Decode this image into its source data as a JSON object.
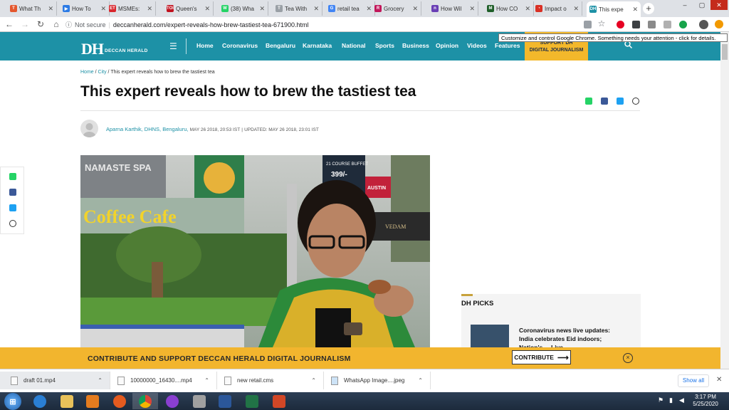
{
  "browser": {
    "tabs": [
      {
        "label": "What Th",
        "fav": "T",
        "color": "#e4572e"
      },
      {
        "label": "How To",
        "fav": "▶",
        "color": "#2c7be5"
      },
      {
        "label": "MSMEs:",
        "fav": "ET",
        "color": "#d9262c"
      },
      {
        "label": "Queen's",
        "fav": "TOI",
        "color": "#c1121f"
      },
      {
        "label": "(38) Wha",
        "fav": "W",
        "color": "#25d366"
      },
      {
        "label": "Tea With",
        "fav": "T",
        "color": "#9aa0a6"
      },
      {
        "label": "retail tea",
        "fav": "G",
        "color": "#4285f4"
      },
      {
        "label": "Grocery",
        "fav": "R",
        "color": "#c2185b"
      },
      {
        "label": "How Wil",
        "fav": "n",
        "color": "#6a3fb5"
      },
      {
        "label": "How CO",
        "fav": "M",
        "color": "#1f5f2a"
      },
      {
        "label": "Impact o",
        "fav": "◔",
        "color": "#d93025"
      },
      {
        "label": "This expe",
        "fav": "DH",
        "color": "#1d91a6",
        "active": true
      }
    ],
    "new_tab": "+",
    "security": "Not secure",
    "url": "deccanherald.com/expert-reveals-how-brew-tastiest-tea-671900.html",
    "tooltip": "Customize and control Google Chrome. Something needs your attention - click for details."
  },
  "site": {
    "logo": "DH",
    "logo_sub": "DECCAN HERALD",
    "nav": [
      "Home",
      "Coronavirus",
      "Bengaluru",
      "Karnataka",
      "National",
      "Sports",
      "Business",
      "Opinion",
      "Videos",
      "Features"
    ],
    "support_line1": "SUPPORT DH",
    "support_line2": "DIGITAL JOURNALISM",
    "accent": "#1d91a6"
  },
  "article": {
    "breadcrumb": [
      "Home",
      "City"
    ],
    "breadcrumb_current": "This expert reveals how to brew the tastiest tea",
    "headline": "This expert reveals how to brew the tastiest tea",
    "author": "Aparna Karthik, DHNS, Bengaluru,",
    "published": "MAY 26 2018, 20:53 IST",
    "updated": "UPDATED: MAY 26 2018, 23:01 IST"
  },
  "photo_signs": {
    "spa": "NAMASTE SPA",
    "cafe": "Coffee Cafe",
    "buffet": "21 COURSE BUFFET",
    "price": "399/-",
    "austin": "AUSTIN",
    "vedam": "VEDAM"
  },
  "sidebar": {
    "heading": "DH PICKS",
    "pick_text": "Coronavirus news live updates: India celebrates Eid indoors; Nation's ... Live"
  },
  "banner": {
    "text": "CONTRIBUTE AND SUPPORT DECCAN HERALD DIGITAL JOURNALISM",
    "button": "CONTRIBUTE",
    "arrow": "⟶",
    "close": "×",
    "color": "#f2b52e"
  },
  "downloads": {
    "items": [
      "draft 01.mp4",
      "10000000_16430....mp4",
      "new retail.cms",
      "WhatsApp Image....jpeg"
    ],
    "show_all": "Show all"
  },
  "taskbar": {
    "time": "3:17 PM",
    "date": "5/25/2020"
  }
}
